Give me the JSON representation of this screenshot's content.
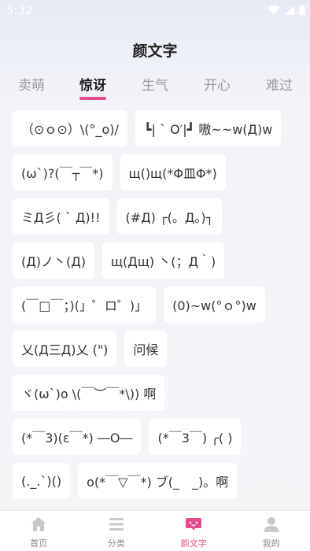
{
  "status": {
    "time": "5:32"
  },
  "header": {
    "title": "颜文字"
  },
  "tabs": [
    {
      "label": "卖萌",
      "active": false
    },
    {
      "label": "惊讶",
      "active": true
    },
    {
      "label": "生气",
      "active": false
    },
    {
      "label": "开心",
      "active": false
    },
    {
      "label": "难过",
      "active": false
    }
  ],
  "items": [
    "（⊙ｏ⊙）\\(°_o)/",
    "┗| ` O′|┛ 嗷~~w(Д)w",
    "(ω`)?(￣┬￣*)",
    "щ()щ(*Φ皿Φ*)",
    "ミД彡( ` Д)!!",
    "(#Д) ┌(。Д。)┐",
    "(Д)ノ丶(Д)",
    "щ(Дщ) 丶(；Д｀)",
    "(￣□￣；)(」゜ロ゜)」",
    "(0)~w(°ｏ°)w",
    "乂(Д三Д)乂 (\")",
    "问候",
    "ヾ(ω`)o \\(￣︶￣*\\)) 啊",
    "(*￣3)(ε￣*) ―O―",
    "(*￣3￣) ╭( )",
    "(._.`)()",
    "o(*￣▽￣*) ブ(_　_)。啊"
  ],
  "nav": [
    {
      "label": "首页",
      "icon": "home-icon",
      "active": false
    },
    {
      "label": "分类",
      "icon": "menu-list-icon",
      "active": false
    },
    {
      "label": "颜文字",
      "icon": "kaomoji-chat-icon",
      "active": true
    },
    {
      "label": "我的",
      "icon": "user-icon",
      "active": false
    }
  ],
  "colors": {
    "accent": "#e84a8f",
    "nav_inactive": "#c8c8c8",
    "background": "#f5f5f8"
  }
}
